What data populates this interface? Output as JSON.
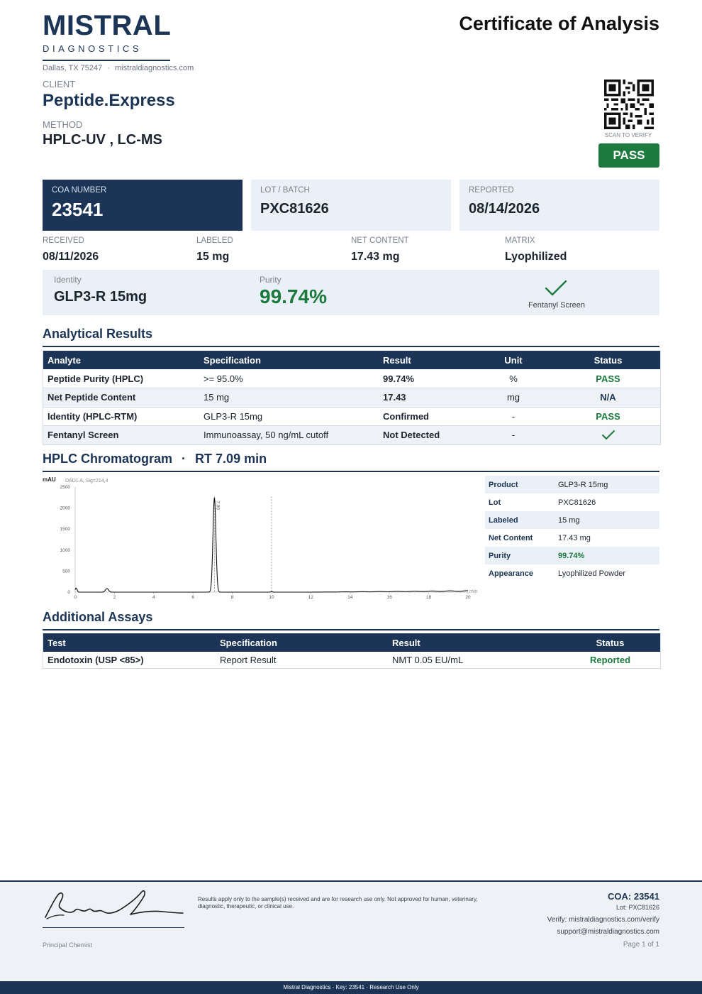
{
  "brand": {
    "name": "MISTRAL",
    "sub": "DIAGNOSTICS",
    "address": "Dallas, TX 75247",
    "sep": "·",
    "website": "mistraldiagnostics.com",
    "colors": {
      "navy": "#1c3557",
      "green": "#1d7a3e",
      "light": "#eaf0f7"
    }
  },
  "doc_title": "Certificate of Analysis",
  "client": {
    "label": "CLIENT",
    "value": "Peptide.Express"
  },
  "method": {
    "label": "METHOD",
    "value": "HPLC-UV , LC-MS"
  },
  "qr": {
    "caption": "SCAN TO VERIFY",
    "icon": "qr-code-icon"
  },
  "status_badge": "PASS",
  "summary": {
    "coa": {
      "label": "COA NUMBER",
      "value": "23541"
    },
    "lot": {
      "label": "LOT / BATCH",
      "value": "PXC81626"
    },
    "reported": {
      "label": "REPORTED",
      "value": "08/14/2026"
    }
  },
  "meta": {
    "received": {
      "label": "RECEIVED",
      "value": "08/11/2026"
    },
    "labeled": {
      "label": "LABELED",
      "value": "15 mg"
    },
    "net_content": {
      "label": "NET CONTENT",
      "value": "17.43 mg"
    },
    "matrix": {
      "label": "MATRIX",
      "value": "Lyophilized"
    }
  },
  "identity": {
    "label": "Identity",
    "value": "GLP3-R 15mg"
  },
  "purity": {
    "label": "Purity",
    "value": "99.74%"
  },
  "fentanyl": {
    "label": "Fentanyl Screen",
    "icon": "checkmark-icon"
  },
  "analytical": {
    "title": "Analytical Results",
    "headers": [
      "Analyte",
      "Specification",
      "Result",
      "Unit",
      "Status"
    ],
    "rows": [
      [
        "Peptide Purity (HPLC)",
        ">= 95.0%",
        "99.74%",
        "%",
        "PASS"
      ],
      [
        "Net Peptide Content",
        "15 mg",
        "17.43",
        "mg",
        "N/A"
      ],
      [
        "Identity (HPLC-RTM)",
        "GLP3-R 15mg",
        "Confirmed",
        "-",
        "PASS"
      ],
      [
        "Fentanyl Screen",
        "Immunoassay, 50 ng/mL cutoff",
        "Not Detected",
        "-",
        ""
      ]
    ]
  },
  "chromatogram": {
    "title": "HPLC Chromatogram",
    "sep": "·",
    "rt": "RT 7.09 min"
  },
  "chart_data": {
    "type": "line",
    "title": "",
    "subtitle": "DAD1 A, Sig=214,4",
    "ylabel": "mAU",
    "xlabel": "min",
    "xlim": [
      0,
      20
    ],
    "ylim": [
      0,
      2500
    ],
    "xticks": [
      0,
      2,
      4,
      6,
      8,
      10,
      12,
      14,
      16,
      18,
      20
    ],
    "yticks": [
      0,
      500,
      1000,
      1500,
      2000,
      2500
    ],
    "grid": false,
    "peaks": [
      {
        "rt": 0.05,
        "height": 95,
        "width": 0.05
      },
      {
        "rt": 1.62,
        "height": 85,
        "width": 0.08
      },
      {
        "rt": 7.09,
        "height": 2240,
        "width": 0.075,
        "label": "7.09"
      },
      {
        "rt": 10.0,
        "height": 18,
        "width": 0.04
      }
    ],
    "baseline_drift": {
      "start": 12.0,
      "end": 20.0,
      "max": 35
    },
    "marker_lines": [
      7.09,
      10.0
    ]
  },
  "sample_info": [
    {
      "key": "Product",
      "value": "GLP3-R 15mg"
    },
    {
      "key": "Lot",
      "value": "PXC81626"
    },
    {
      "key": "Labeled",
      "value": "15 mg"
    },
    {
      "key": "Net Content",
      "value": "17.43 mg"
    },
    {
      "key": "Purity",
      "value": "99.74%"
    },
    {
      "key": "Appearance",
      "value": "Lyophilized Powder"
    }
  ],
  "additional": {
    "title": "Additional Assays",
    "headers": [
      "Test",
      "Specification",
      "Result",
      "Status"
    ],
    "rows": [
      [
        "Endotoxin (USP <85>)",
        "Report Result",
        "NMT 0.05 EU/mL",
        "Reported"
      ]
    ]
  },
  "footer": {
    "signature_label": "Principal Chemist",
    "disclaimer": "Results apply only to the sample(s) received and are for research use only. Not approved for human, veterinary, diagnostic, therapeutic, or clinical use.",
    "coa": "COA: 23541",
    "lot": "Lot: PXC81626",
    "verify": "Verify: mistraldiagnostics.com/verify",
    "support": "support@mistraldiagnostics.com",
    "page": "Page 1 of 1",
    "bar": "Mistral Diagnostics  ·  Key: 23541  ·  Research Use Only"
  }
}
